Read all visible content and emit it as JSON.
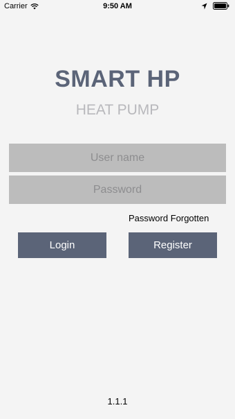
{
  "status_bar": {
    "carrier": "Carrier",
    "time": "9:50 AM",
    "icons": [
      "wifi-icon",
      "location-arrow-icon",
      "battery-icon"
    ]
  },
  "app": {
    "title": "SMART HP",
    "subtitle": "HEAT PUMP",
    "version": "1.1.1"
  },
  "form": {
    "username": {
      "placeholder": "User name",
      "value": ""
    },
    "password": {
      "placeholder": "Password",
      "value": ""
    },
    "forgot_label": "Password Forgotten",
    "login_label": "Login",
    "register_label": "Register"
  },
  "colors": {
    "background": "#f4f4f4",
    "accent": "#5b6478",
    "field_bg": "#bcbcbc",
    "subtitle": "#b8b8bc"
  }
}
